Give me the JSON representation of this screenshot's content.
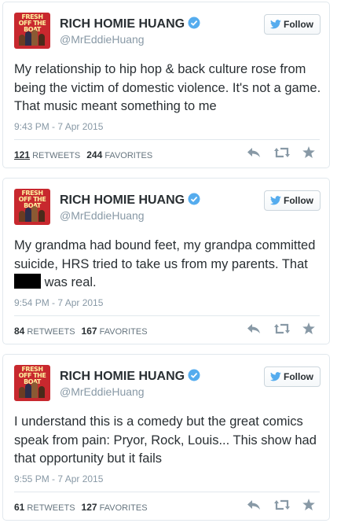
{
  "follow_label": "Follow",
  "retweets_label": "RETWEETS",
  "favorites_label": "FAVORITES",
  "tweets": [
    {
      "name": "RICH HOMIE HUANG",
      "handle": "@MrEddieHuang",
      "text": "My relationship to hip hop & back culture rose from being the victim of domestic violence. It's not a game. That music meant something to me",
      "time": "9:43 PM - 7 Apr 2015",
      "retweets": "121",
      "favorites": "244"
    },
    {
      "name": "RICH HOMIE HUANG",
      "handle": "@MrEddieHuang",
      "text_before": "My grandma had bound feet, my grandpa committed suicide, HRS tried to take us from my parents. That",
      "text_after": "was real.",
      "time": "9:54 PM - 7 Apr 2015",
      "retweets": "84",
      "favorites": "167"
    },
    {
      "name": "RICH HOMIE HUANG",
      "handle": "@MrEddieHuang",
      "text": "I understand this is a comedy but the great comics speak from pain: Pryor, Rock, Louis... This show had that opportunity but it fails",
      "time": "9:55 PM - 7 Apr 2015",
      "retweets": "61",
      "favorites": "127"
    }
  ],
  "avatar_logo": "FRESH OFF THE BOAT",
  "colors": {
    "verified": "#55acee",
    "twitter_bird": "#55acee",
    "meta_text": "#8899a6",
    "action_icons": "#8899a6",
    "avatar_bg": "#c8282e"
  },
  "icons": [
    "verified-badge-icon",
    "twitter-bird-icon",
    "reply-icon",
    "retweet-icon",
    "favorite-star-icon"
  ]
}
